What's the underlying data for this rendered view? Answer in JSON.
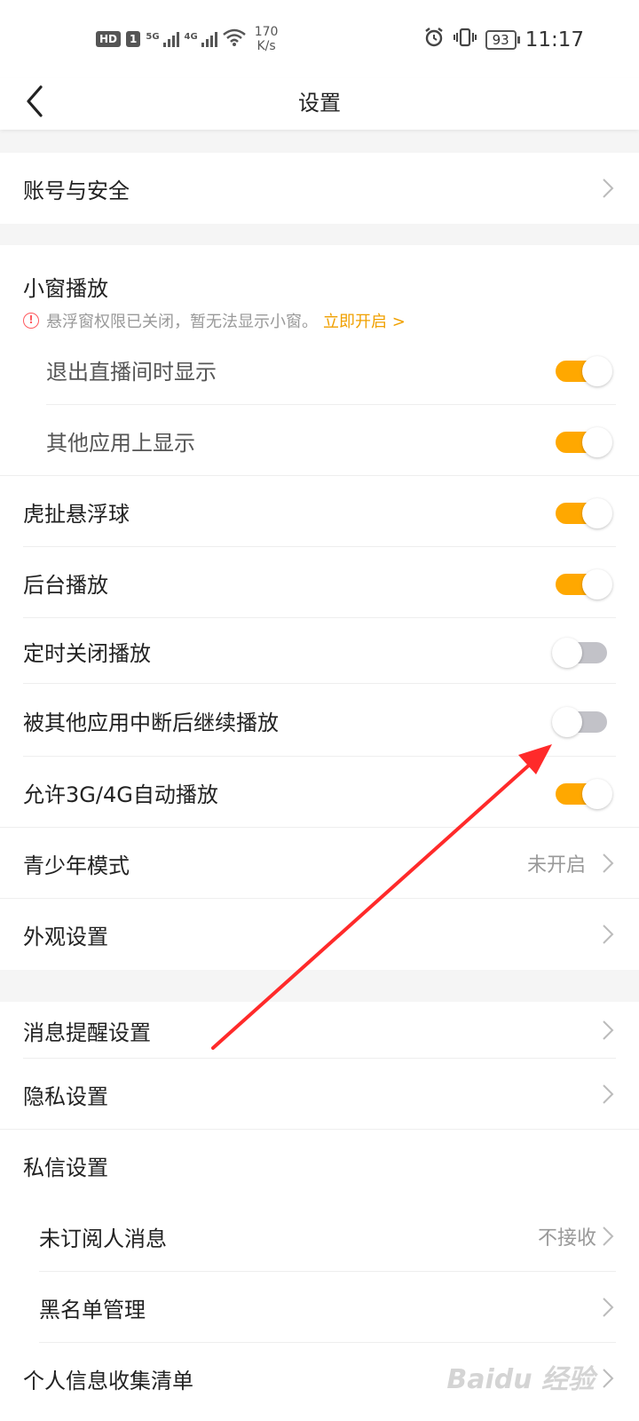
{
  "status_bar": {
    "hd": "HD",
    "sim": "1",
    "net1": "5G",
    "net2": "4G",
    "speed_value": "170",
    "speed_unit": "K/s",
    "battery": "93",
    "time": "11:17"
  },
  "header": {
    "title": "设置"
  },
  "account": {
    "label": "账号与安全"
  },
  "mini_window": {
    "title": "小窗播放",
    "notice_text": "悬浮窗权限已关闭，暂无法显示小窗。",
    "notice_link": "立即开启 >",
    "exit_live": {
      "label": "退出直播间时显示",
      "on": true
    },
    "other_apps": {
      "label": "其他应用上显示",
      "on": true
    }
  },
  "toggles": {
    "float_ball": {
      "label": "虎扯悬浮球",
      "on": true
    },
    "background_play": {
      "label": "后台播放",
      "on": true
    },
    "timer_close": {
      "label": "定时关闭播放",
      "on": false
    },
    "resume_after_interrupt": {
      "label": "被其他应用中断后继续播放",
      "on": false
    },
    "mobile_autoplay": {
      "label": "允许3G/4G自动播放",
      "on": true
    }
  },
  "youth_mode": {
    "label": "青少年模式",
    "value": "未开启"
  },
  "appearance": {
    "label": "外观设置"
  },
  "notifications": {
    "label": "消息提醒设置"
  },
  "privacy": {
    "label": "隐私设置"
  },
  "dm": {
    "title": "私信设置",
    "unsubscribed": {
      "label": "未订阅人消息",
      "value": "不接收"
    },
    "blacklist": {
      "label": "黑名单管理"
    }
  },
  "personal_info": {
    "label": "个人信息收集清单"
  },
  "watermark": "Baidu 经验",
  "colors": {
    "accent": "#ffa800",
    "link": "#f0a000",
    "warn": "#ff5a5f",
    "annotation_arrow": "#ff2a2a"
  }
}
